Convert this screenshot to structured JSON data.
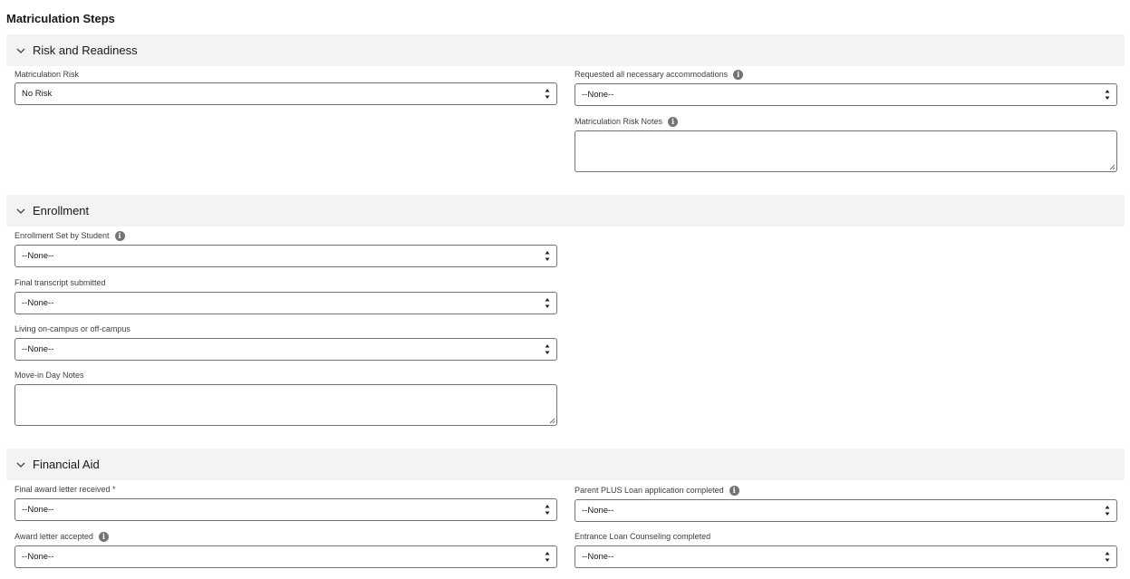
{
  "page_title": "Matriculation Steps",
  "sections": {
    "risk": {
      "title": "Risk and Readiness",
      "matric_risk": {
        "label": "Matriculation Risk",
        "value": "No Risk"
      },
      "accommodations": {
        "label": "Requested all necessary accommodations",
        "value": "--None--"
      },
      "risk_notes": {
        "label": "Matriculation Risk Notes",
        "value": ""
      }
    },
    "enrollment": {
      "title": "Enrollment",
      "enrollment_set": {
        "label": "Enrollment Set by Student",
        "value": "--None--"
      },
      "transcript": {
        "label": "Final transcript submitted",
        "value": "--None--"
      },
      "living": {
        "label": "Living on-campus or off-campus",
        "value": "--None--"
      },
      "movein_notes": {
        "label": "Move-in Day Notes",
        "value": ""
      }
    },
    "financial": {
      "title": "Financial Aid",
      "award_received": {
        "label": "Final award letter received *",
        "value": "--None--"
      },
      "award_accepted": {
        "label": "Award letter accepted",
        "value": "--None--"
      },
      "plus_loan": {
        "label": "Parent PLUS Loan application completed",
        "value": "--None--"
      },
      "entrance_counseling": {
        "label": "Entrance Loan Counseling completed",
        "value": "--None--"
      }
    }
  },
  "icons": {
    "chevron": "chevron-down-icon",
    "info": "info-icon",
    "select_arrows": "up-down-arrows-icon",
    "resize": "resize-grip-icon"
  },
  "colors": {
    "section_bg": "#f3f3f3",
    "border": "#747474",
    "text": "#181818",
    "label": "#3e3e3c"
  }
}
